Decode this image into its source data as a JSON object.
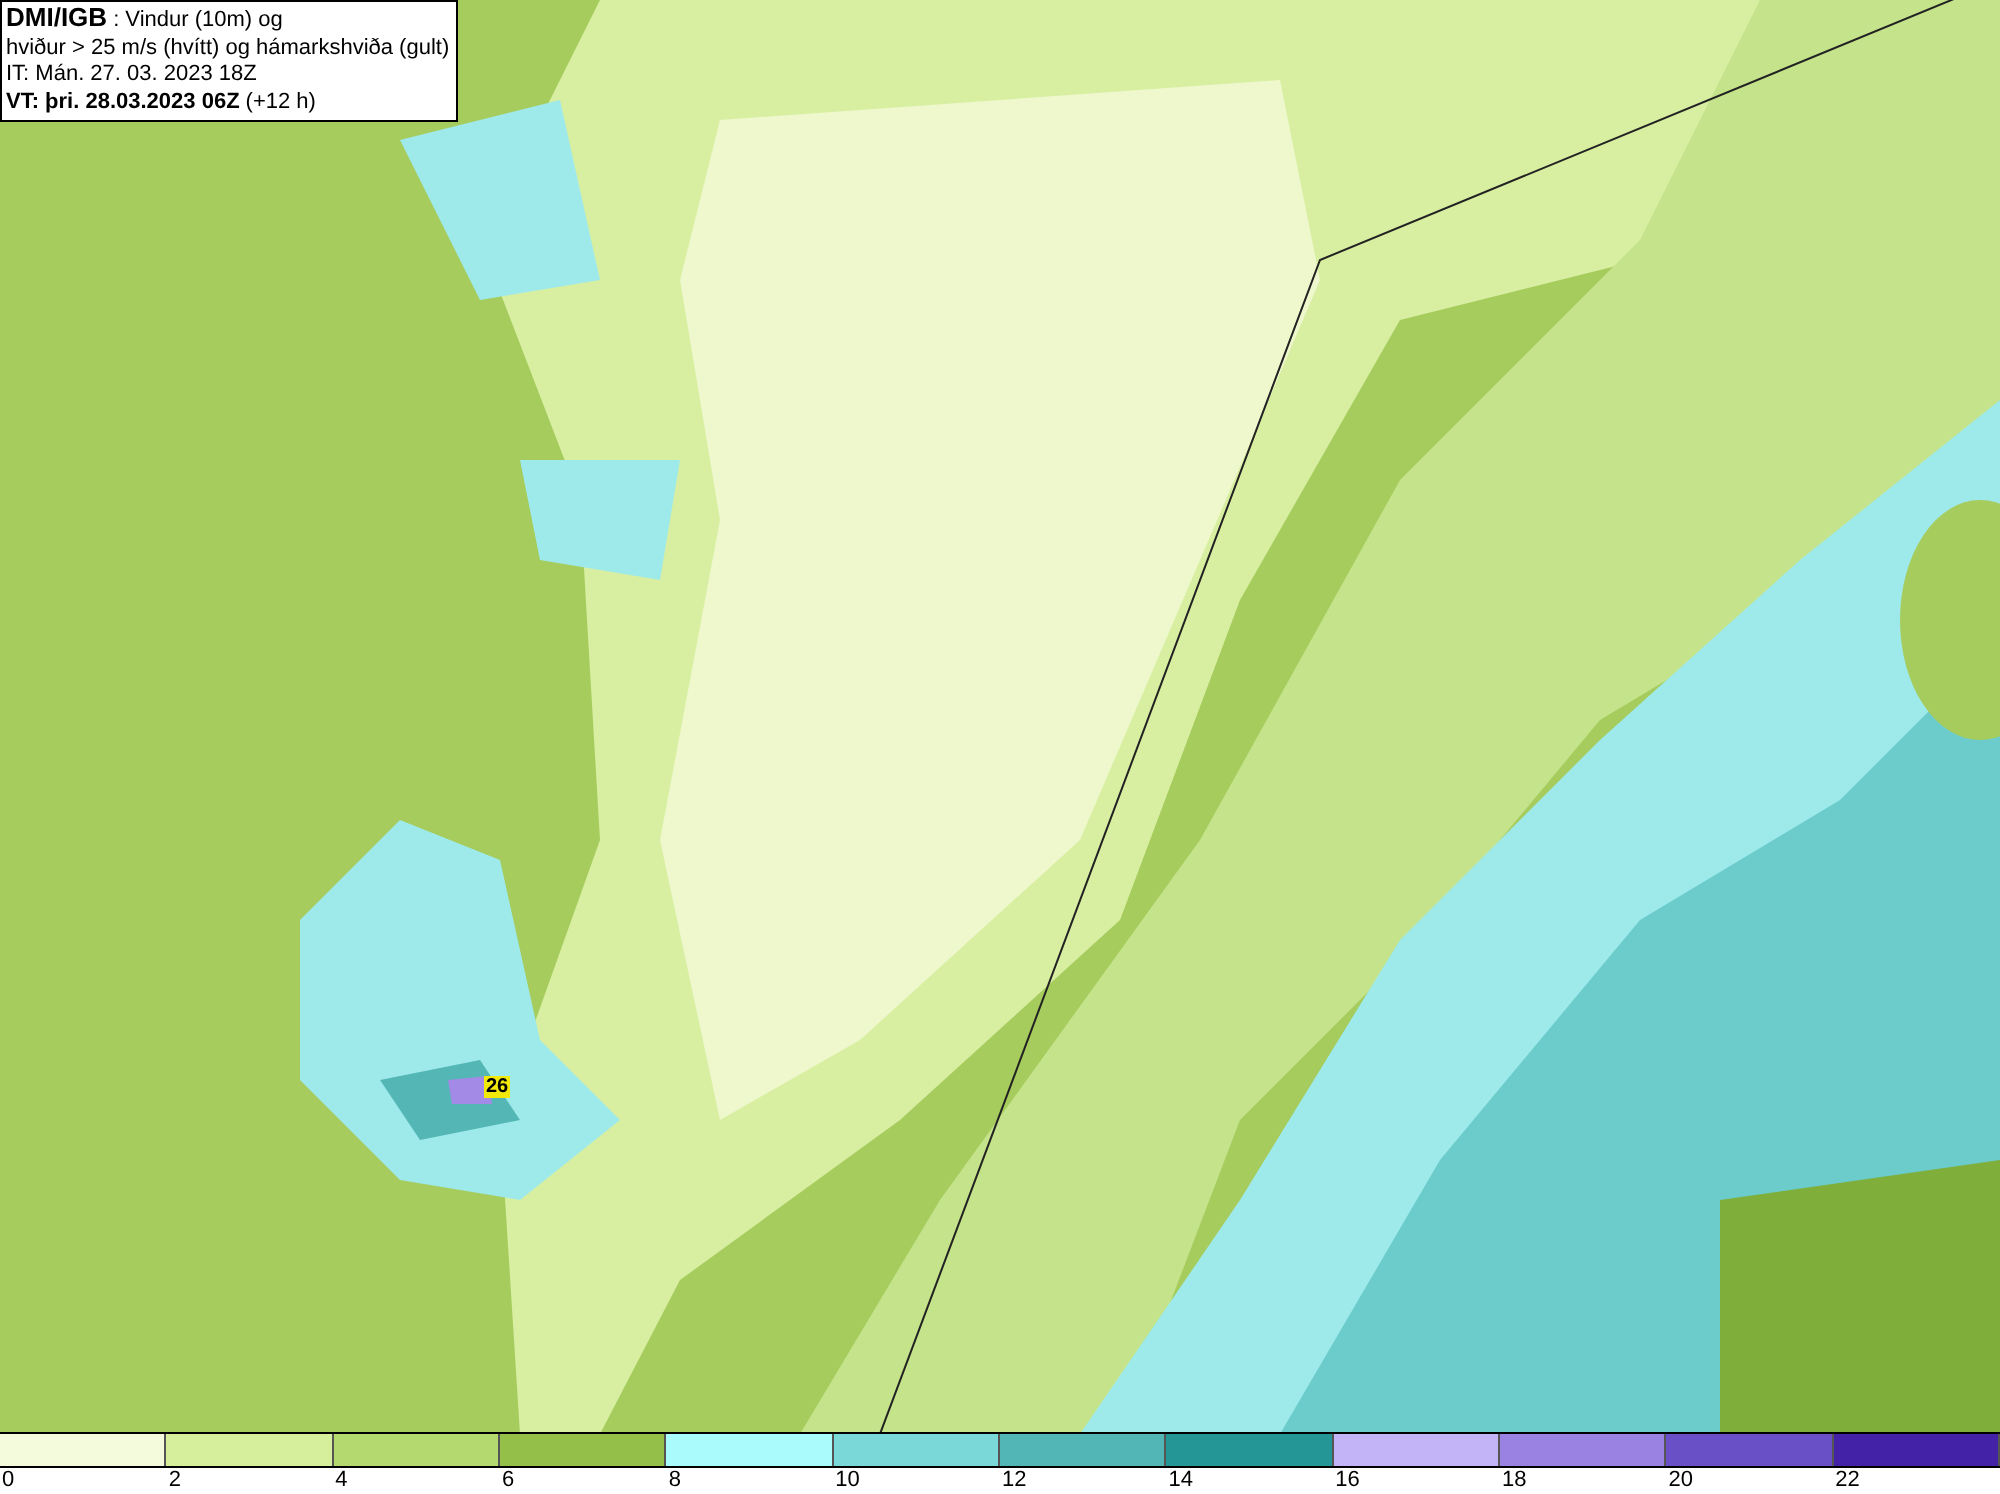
{
  "header": {
    "brand": "DMI/IGB",
    "title": ": Vindur (10m) og",
    "subtitle": "hviður > 25 m/s (hvítt) og hámarkshviða (gult)",
    "issue_time": "IT: Mán. 27. 03. 2023 18Z",
    "valid_label": "VT: þri. 28.03.2023 06Z",
    "valid_offset": "(+12 h)"
  },
  "map": {
    "gust_label": "26"
  },
  "legend": {
    "swatches": [
      {
        "color": "#f4fbdc"
      },
      {
        "color": "#d5ef9c"
      },
      {
        "color": "#b4d96e"
      },
      {
        "color": "#94bf48"
      },
      {
        "color": "#aafcfc"
      },
      {
        "color": "#7ad8d8"
      },
      {
        "color": "#52b6b6"
      },
      {
        "color": "#249696"
      },
      {
        "color": "#c2b4f6"
      },
      {
        "color": "#9a82e2"
      },
      {
        "color": "#6a50c6"
      },
      {
        "color": "#4422a8"
      }
    ],
    "ticks": [
      "0",
      "2",
      "4",
      "6",
      "8",
      "10",
      "12",
      "14",
      "16",
      "18",
      "20",
      "22"
    ]
  }
}
